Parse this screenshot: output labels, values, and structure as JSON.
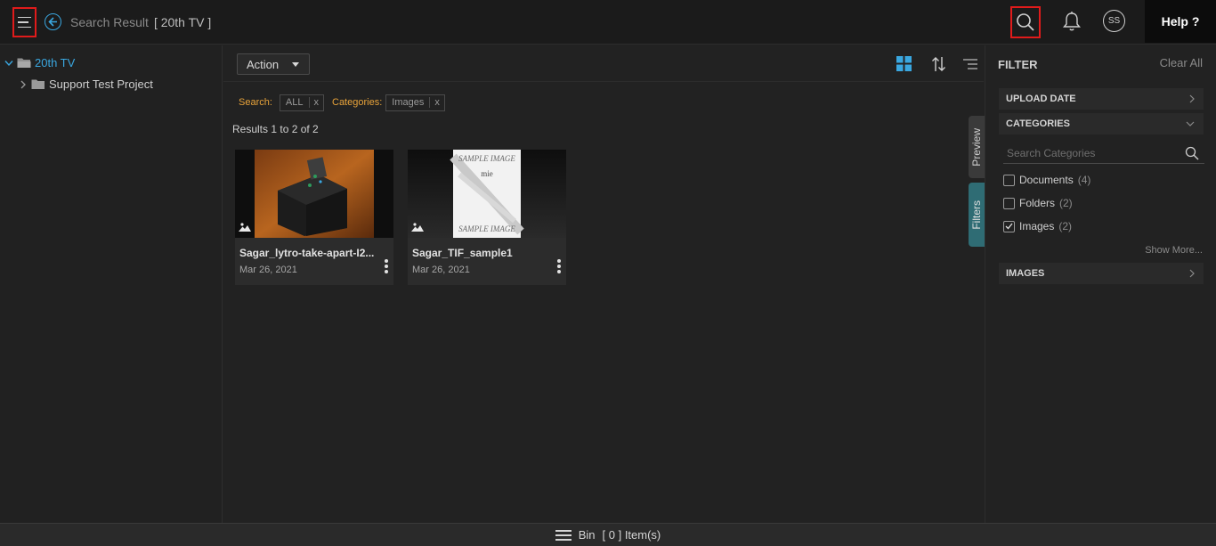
{
  "header": {
    "crumb_label": "Search Result",
    "crumb_location": "[ 20th TV ]",
    "avatar_initials": "SS",
    "help_label": "Help ?"
  },
  "tree": {
    "root_label": "20th TV",
    "child_label": "Support Test Project"
  },
  "toolbar": {
    "action_label": "Action"
  },
  "search_filters": {
    "search_key": "Search:",
    "search_value": "ALL",
    "categories_key": "Categories:",
    "categories_value": "Images",
    "remove_label": "x"
  },
  "results_text": "Results 1 to 2 of 2",
  "cards": [
    {
      "name": "Sagar_lytro-take-apart-I2...",
      "date": "Mar 26, 2021"
    },
    {
      "name": "Sagar_TIF_sample1",
      "date": "Mar 26, 2021"
    }
  ],
  "thumb_text": {
    "sample_top": "SAMPLE IMAGE",
    "sample_mid": "mie",
    "sample_bottom": "SAMPLE IMAGE"
  },
  "side_tabs": {
    "preview": "Preview",
    "filters": "Filters"
  },
  "filter_panel": {
    "title": "FILTER",
    "clear_all": "Clear All",
    "upload_date": "UPLOAD DATE",
    "categories": "CATEGORIES",
    "search_placeholder": "Search Categories",
    "items": [
      {
        "label": "Documents",
        "count": "(4)",
        "checked": false
      },
      {
        "label": "Folders",
        "count": "(2)",
        "checked": false
      },
      {
        "label": "Images",
        "count": "(2)",
        "checked": true
      }
    ],
    "show_more": "Show More...",
    "images_section": "IMAGES"
  },
  "bin": {
    "label": "Bin",
    "count_text": "[ 0 ] Item(s)"
  },
  "colors": {
    "accent_blue": "#3aa7e0",
    "search_orange": "#e8a33a",
    "highlight_red": "#e01b1b",
    "filters_tab_teal": "#2f6c74"
  }
}
